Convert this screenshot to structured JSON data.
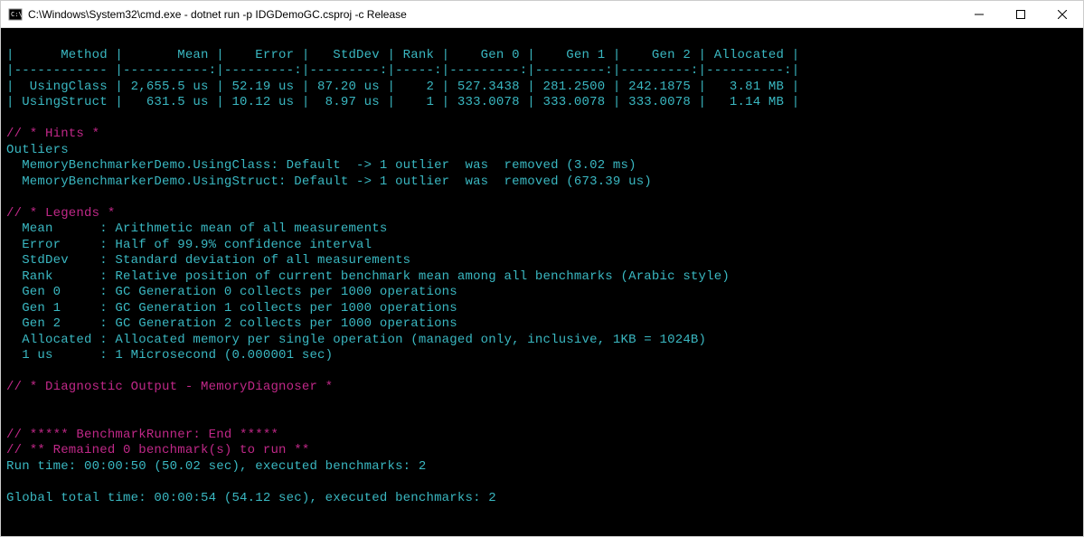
{
  "window": {
    "title": "C:\\Windows\\System32\\cmd.exe - dotnet  run -p IDGDemoGC.csproj -c Release"
  },
  "table": {
    "headers": [
      "Method",
      "Mean",
      "Error",
      "StdDev",
      "Rank",
      "Gen 0",
      "Gen 1",
      "Gen 2",
      "Allocated"
    ],
    "row1": {
      "method": "UsingClass",
      "mean": "2,655.5 us",
      "error": "52.19 us",
      "stddev": "87.20 us",
      "rank": "2",
      "gen0": "527.3438",
      "gen1": "281.2500",
      "gen2": "242.1875",
      "allocated": "3.81 MB"
    },
    "row2": {
      "method": "UsingStruct",
      "mean": "631.5 us",
      "error": "10.12 us",
      "stddev": "8.97 us",
      "rank": "1",
      "gen0": "333.0078",
      "gen1": "333.0078",
      "gen2": "333.0078",
      "allocated": "1.14 MB"
    }
  },
  "hints": {
    "header": "// * Hints *",
    "outliers_label": "Outliers",
    "line1": "  MemoryBenchmarkerDemo.UsingClass: Default  -> 1 outlier  was  removed (3.02 ms)",
    "line2": "  MemoryBenchmarkerDemo.UsingStruct: Default -> 1 outlier  was  removed (673.39 us)"
  },
  "legends": {
    "header": "// * Legends *",
    "mean": "  Mean      : Arithmetic mean of all measurements",
    "error": "  Error     : Half of 99.9% confidence interval",
    "stddev": "  StdDev    : Standard deviation of all measurements",
    "rank": "  Rank      : Relative position of current benchmark mean among all benchmarks (Arabic style)",
    "gen0": "  Gen 0     : GC Generation 0 collects per 1000 operations",
    "gen1": "  Gen 1     : GC Generation 1 collects per 1000 operations",
    "gen2": "  Gen 2     : GC Generation 2 collects per 1000 operations",
    "allocated": "  Allocated : Allocated memory per single operation (managed only, inclusive, 1KB = 1024B)",
    "us": "  1 us      : 1 Microsecond (0.000001 sec)"
  },
  "diagnostic": {
    "header": "// * Diagnostic Output - MemoryDiagnoser *"
  },
  "footer": {
    "end": "// ***** BenchmarkRunner: End *****",
    "remain": "// ** Remained 0 benchmark(s) to run **",
    "runtime": "Run time: 00:00:50 (50.02 sec), executed benchmarks: 2",
    "global": "Global total time: 00:00:54 (54.12 sec), executed benchmarks: 2"
  },
  "header_line": "|      Method |       Mean |    Error |   StdDev | Rank |    Gen 0 |    Gen 1 |    Gen 2 | Allocated |",
  "sep_line": "|------------ |-----------:|---------:|---------:|-----:|---------:|---------:|---------:|----------:|",
  "row1_line": "|  UsingClass | 2,655.5 us | 52.19 us | 87.20 us |    2 | 527.3438 | 281.2500 | 242.1875 |   3.81 MB |",
  "row2_line": "| UsingStruct |   631.5 us | 10.12 us |  8.97 us |    1 | 333.0078 | 333.0078 | 333.0078 |   1.14 MB |"
}
